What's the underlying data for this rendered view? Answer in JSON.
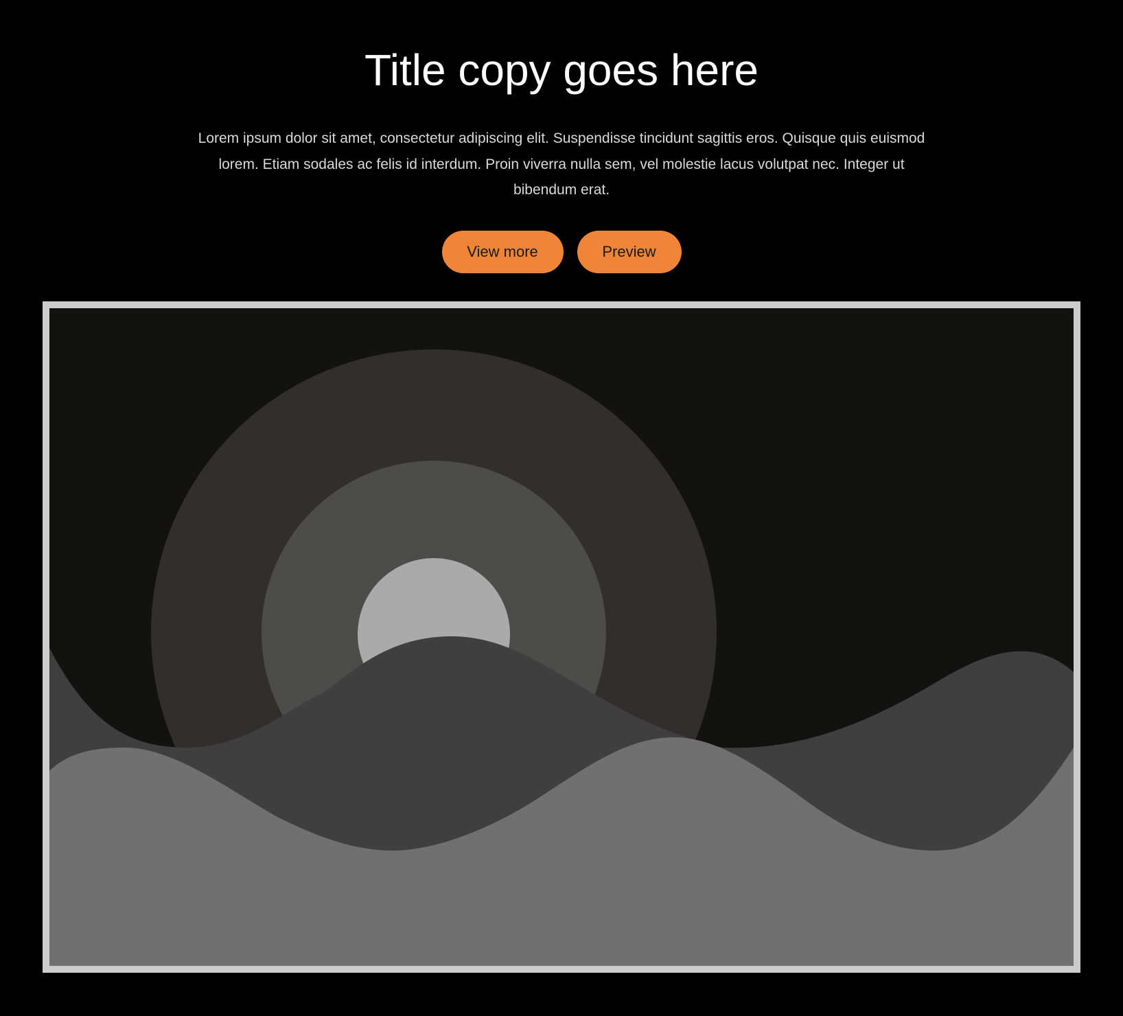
{
  "hero": {
    "title": "Title copy goes here",
    "description": "Lorem ipsum dolor sit amet, consectetur adipiscing elit. Suspendisse tincidunt sagittis eros. Quisque quis euismod lorem. Etiam sodales ac felis id interdum. Proin viverra nulla sem, vel molestie lacus volutpat nec. Integer ut bibendum erat.",
    "buttons": {
      "view_more": "View more",
      "preview": "Preview"
    }
  },
  "illustration": {
    "icon": "landscape-image-icon",
    "colors": {
      "frame_border": "#cccccc",
      "sky": "#121210",
      "outer_ring": "#322e2d",
      "middle_ring": "#4c4c4a",
      "sun": "#aaaaaa",
      "back_hills": "#3f3f3f",
      "front_hills": "#707070"
    }
  },
  "theme": {
    "background": "#000000",
    "accent": "#f08539"
  }
}
